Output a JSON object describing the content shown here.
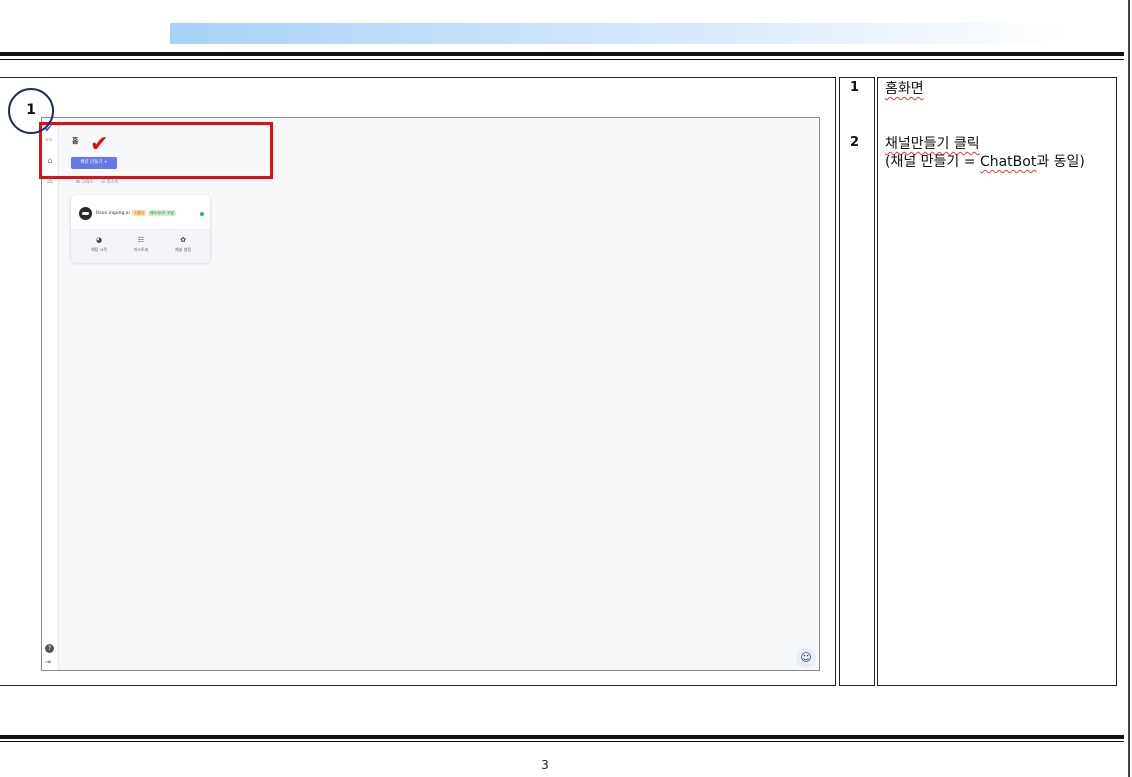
{
  "callout_number": "1",
  "steps": [
    {
      "num": "1",
      "text": "홈화면"
    },
    {
      "num": "2",
      "line1": "채널만들기 클릭",
      "line2_prefix": "(채널 만들기 = ",
      "line2_word": "ChatBot",
      "line2_suffix": "과 동일)"
    }
  ],
  "screenshot": {
    "logo_sub": "ㅁㅁ",
    "page_title": "홈",
    "create_button": "채널 만들기 +",
    "view_tabs": [
      "⊞ 그리드",
      "☰ 리스트"
    ],
    "card": {
      "name": "Raon.ingung.ai",
      "badge_a": "스튜디",
      "badge_b": "베이비이드 모델",
      "actions": [
        {
          "icon": "chat-icon",
          "glyph": "◕",
          "label": "채팅 시작"
        },
        {
          "icon": "history-icon",
          "glyph": "☷",
          "label": "히스토리"
        },
        {
          "icon": "gear-icon",
          "glyph": "✿",
          "label": "채널 설정"
        }
      ]
    }
  },
  "page_number": "3",
  "colors": {
    "highlight": "#e01010",
    "primary_button": "#6478e8",
    "header_gradient_start": "#a9d1f7"
  }
}
